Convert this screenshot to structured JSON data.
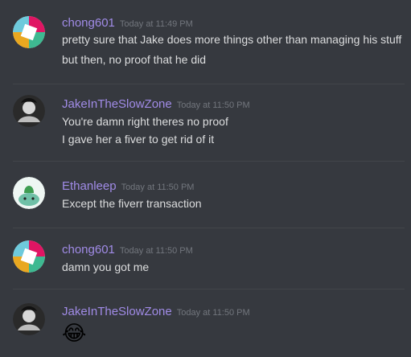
{
  "messages": [
    {
      "author": "chong601",
      "timestamp": "Today at 11:49 PM",
      "avatar": "chong601-avatar",
      "lines": [
        "pretty sure that Jake does more things other than managing his stuff",
        "but then, no proof that he did"
      ]
    },
    {
      "author": "JakeInTheSlowZone",
      "timestamp": "Today at 11:50 PM",
      "avatar": "jake-avatar",
      "lines": [
        "You're damn right theres no proof",
        "I gave her a fiver to get rid of it"
      ]
    },
    {
      "author": "Ethanleep",
      "timestamp": "Today at 11:50 PM",
      "avatar": "ethanleep-avatar",
      "lines": [
        "Except the fiverr transaction"
      ]
    },
    {
      "author": "chong601",
      "timestamp": "Today at 11:50 PM",
      "avatar": "chong601-avatar",
      "lines": [
        "damn you got me"
      ]
    },
    {
      "author": "JakeInTheSlowZone",
      "timestamp": "Today at 11:50 PM",
      "avatar": "jake-avatar",
      "emoji": "😂",
      "emoji_name": "joy-emoji"
    }
  ],
  "colors": {
    "background": "#36393f",
    "username": "#a08be6",
    "timestamp": "#72767d",
    "text": "#dcddde",
    "divider": "#42454a"
  }
}
